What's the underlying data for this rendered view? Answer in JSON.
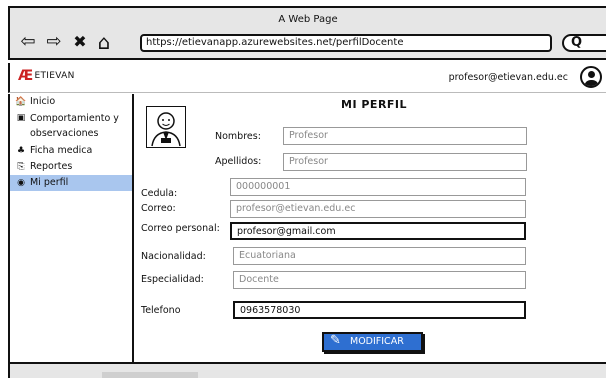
{
  "window": {
    "title": "A Web Page"
  },
  "browser": {
    "url": "https://etievanapp.azurewebsites.net/perfilDocente",
    "back_glyph": "⇦",
    "forward_glyph": "⇨",
    "close_glyph": "✖",
    "home_glyph": "⌂",
    "search_glyph": "Q"
  },
  "header": {
    "logo_mark": "Æ",
    "logo_text": "ETIEVAN",
    "user_email": "profesor@etievan.edu.ec"
  },
  "sidebar": {
    "items": [
      {
        "icon": "home-icon",
        "glyph": "🏠",
        "label": "Inicio"
      },
      {
        "icon": "clipboard-icon",
        "glyph": "▣",
        "label": "Comportamiento y observaciones"
      },
      {
        "icon": "medical-icon",
        "glyph": "♣",
        "label": "Ficha medica"
      },
      {
        "icon": "reports-icon",
        "glyph": "⎘",
        "label": "Reportes"
      },
      {
        "icon": "user-circle-icon",
        "glyph": "◉",
        "label": "Mi perfil",
        "active": true
      }
    ]
  },
  "profile": {
    "title": "MI PERFIL",
    "nombres_label": "Nombres:",
    "nombres_value": "Profesor",
    "apellidos_label": "Apellidos:",
    "apellidos_value": "Profesor",
    "cedula_label": "Cedula:",
    "cedula_value": "000000001",
    "correo_label": "Correo:",
    "correo_value": "profesor@etievan.edu.ec",
    "correo_personal_label": "Correo personal:",
    "correo_personal_value": "profesor@gmail.com",
    "nacionalidad_label": "Nacionalidad:",
    "nacionalidad_value": "Ecuatoriana",
    "especialidad_label": "Especialidad:",
    "especialidad_value": "Docente",
    "telefono_label": "Telefono",
    "telefono_value": "0963578030",
    "modify_button": "MODIFICAR",
    "pencil_glyph": "✎"
  },
  "colors": {
    "accent": "#2e6fd1",
    "active_item": "#a9c6ee",
    "brand": "#cc2222"
  }
}
